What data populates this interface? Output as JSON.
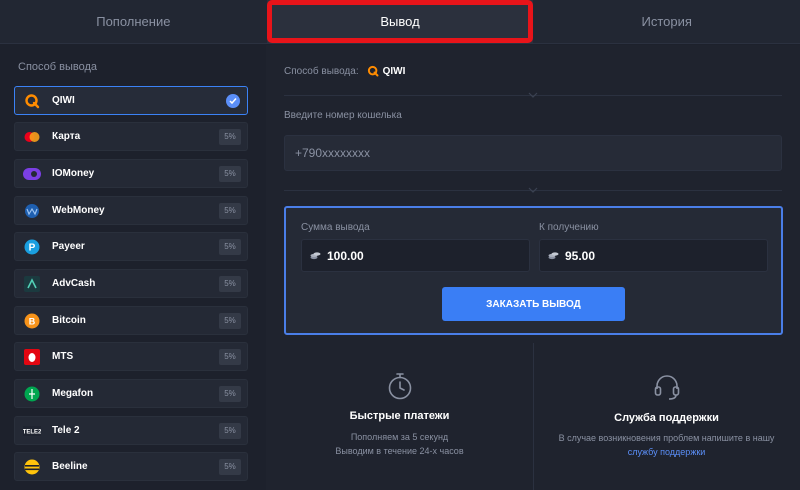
{
  "tabs": [
    {
      "label": "Пополнение",
      "active": false
    },
    {
      "label": "Вывод",
      "active": true
    },
    {
      "label": "История",
      "active": false
    }
  ],
  "sidebar": {
    "title": "Способ вывода",
    "methods": [
      {
        "label": "QIWI",
        "icon": "qiwi-icon",
        "selected": true
      },
      {
        "label": "Карта",
        "icon": "card-icon",
        "fee": "5%"
      },
      {
        "label": "IOMoney",
        "icon": "iomoney-icon",
        "fee": "5%"
      },
      {
        "label": "WebMoney",
        "icon": "webmoney-icon",
        "fee": "5%"
      },
      {
        "label": "Payeer",
        "icon": "payeer-icon",
        "fee": "5%"
      },
      {
        "label": "AdvCash",
        "icon": "advcash-icon",
        "fee": "5%"
      },
      {
        "label": "Bitcoin",
        "icon": "bitcoin-icon",
        "fee": "5%"
      },
      {
        "label": "MTS",
        "icon": "mts-icon",
        "fee": "5%"
      },
      {
        "label": "Megafon",
        "icon": "megafon-icon",
        "fee": "5%"
      },
      {
        "label": "Tele 2",
        "icon": "tele2-icon",
        "fee": "5%"
      },
      {
        "label": "Beeline",
        "icon": "beeline-icon",
        "fee": "5%"
      }
    ]
  },
  "main": {
    "selected_label": "Способ вывода:",
    "selected_method": "QIWI",
    "wallet_label": "Введите номер кошелька",
    "wallet_placeholder": "+790xxxxxxxx",
    "amount_label": "Сумма вывода",
    "amount_value": "100.00",
    "receive_label": "К получению",
    "receive_value": "95.00",
    "order_button": "ЗАКАЗАТЬ ВЫВОД",
    "fast_title": "Быстрые платежи",
    "fast_line1": "Пополняем за 5 секунд",
    "fast_line2": "Выводим в течение 24-х часов",
    "support_title": "Служба поддержки",
    "support_line1": "В случае возникновения проблем напишите в нашу",
    "support_link": "службу поддержки"
  },
  "colors": {
    "accent": "#3a7ef5",
    "highlight": "#e8141a",
    "background": "#1d212c"
  }
}
